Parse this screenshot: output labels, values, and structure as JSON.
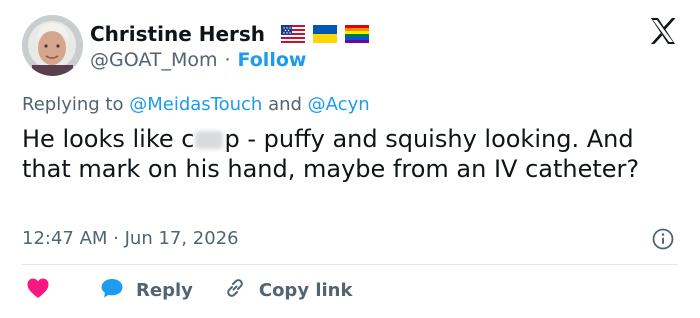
{
  "header": {
    "display_name": "Christine Hersh",
    "handle": "@GOAT_Mom",
    "separator": "·",
    "follow_label": "Follow"
  },
  "icons": {
    "flags": [
      "us-flag-icon",
      "ukraine-flag-icon",
      "rainbow-flag-icon"
    ],
    "logo": "x-logo-icon",
    "info": "info-icon",
    "like": "heart-icon",
    "reply": "speech-bubble-icon",
    "copy": "link-icon"
  },
  "replying": {
    "prefix": "Replying to",
    "mention_1": "@MeidasTouch",
    "conjunction": "and",
    "mention_2": "@Acyn"
  },
  "tweet": {
    "text_before": "He looks like c",
    "text_after": "p - puffy and squishy looking. And that mark on his hand, maybe from an IV catheter?",
    "timestamp": "12:47 AM · Jun 17, 2026"
  },
  "actions": {
    "reply_label": "Reply",
    "copy_label": "Copy link"
  },
  "colors": {
    "accent": "#1d9bf0",
    "like": "#f91880",
    "text": "#0f1419",
    "muted": "#536471"
  }
}
